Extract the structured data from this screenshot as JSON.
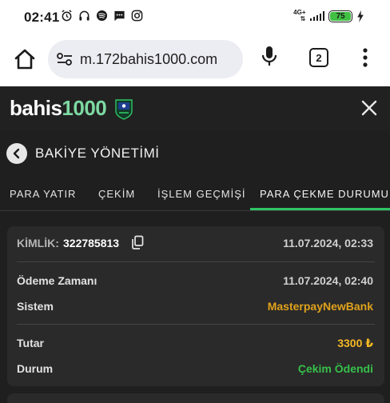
{
  "status_bar": {
    "time": "02:41",
    "network": "4G+",
    "battery": "75",
    "icons": [
      "alarm-icon",
      "headset-icon",
      "spotify-icon",
      "message-icon",
      "instagram-icon"
    ]
  },
  "browser": {
    "url": "m.172bahis1000.com",
    "tab_count": "2"
  },
  "site": {
    "logo_prefix": "bahis",
    "logo_suffix": "1000"
  },
  "page": {
    "title": "BAKİYE YÖNETİMİ"
  },
  "tabs": [
    {
      "label": "PARA YATIR"
    },
    {
      "label": "ÇEKİM"
    },
    {
      "label": "İŞLEM GEÇMİŞİ"
    },
    {
      "label": "PARA ÇEKME DURUMU"
    }
  ],
  "transaction": {
    "id_label": "KİMLİK:",
    "id": "322785813",
    "created": "11.07.2024, 02:33",
    "payment_time_label": "Ödeme Zamanı",
    "payment_time": "11.07.2024, 02:40",
    "system_label": "Sistem",
    "system": "MasterpayNewBank",
    "amount_label": "Tutar",
    "amount": "3300 ₺",
    "status_label": "Durum",
    "status": "Çekim Ödendi"
  },
  "colors": {
    "accent": "#2fc564",
    "amount": "#f5b924",
    "system": "#e0a21b",
    "status": "#36c04a"
  }
}
